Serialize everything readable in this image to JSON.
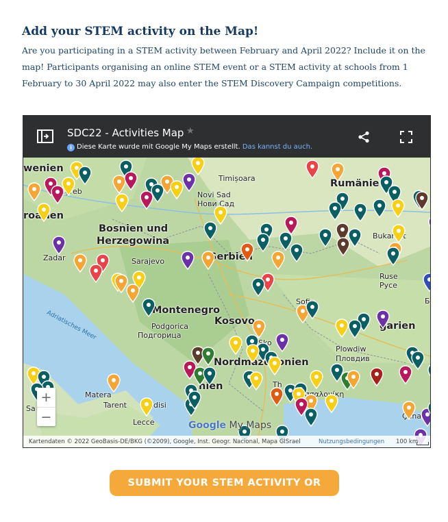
{
  "section": {
    "heading": "Add your STEM activity on the Map!",
    "intro": "Are you participating in a STEM activity between February and April 2022? Include it on the map! Participants organising an online STEM event or a STEM activity at schools from 1 February to 30 April 2022 may also enter the STEM Discovery Campaign competitions."
  },
  "map": {
    "title": "SDC22 - Activities Map",
    "star": "★",
    "info_text": "Diese Karte wurde mit Google My Maps erstellt.",
    "info_link": "Das kannst du auch.",
    "icons": {
      "sidebar": "sidebar-toggle-icon",
      "share": "share-icon",
      "fullscreen": "fullscreen-icon",
      "info": "info-icon"
    },
    "labels": {
      "slovenia": "wenien",
      "zagreb": "agreb",
      "croatia": "roatien",
      "timisoara": "Timișoara",
      "novisad": "Novi Sad",
      "novisad_cyr": "Нови Сад",
      "romania": "Rumänie",
      "bosnia1": "Bosnien und",
      "bosnia2": "Herzegowina",
      "zadar": "Zadar",
      "sarajevo": "Sarajevo",
      "serbia": "Serbien",
      "bucharest": "Bukarest",
      "ruse": "Ruse",
      "ruse_cyr": "Русе",
      "montenegro": "Montenegro",
      "adriatic": "Adriatisches Meer",
      "podgorica": "Podgorica",
      "podgorica_cyr": "Подгорица",
      "kosovo": "Kosovo",
      "sofia": "Sofia",
      "bulgaria": "garien",
      "skopje": "Sko",
      "plovdiv": "Plowdiw",
      "plovdiv_cyr": "Пловдив",
      "north_macedonia": "Nordmazedonien",
      "albania": "nien",
      "matera": "Matera",
      "taranto": "Tarent",
      "brindisi": "indisi",
      "thessaloniki": "Th",
      "thessaloniki2": "Θεσσαλονίκη",
      "lecce": "Lecce",
      "canakkale": "Çanal",
      "sa": "Sa",
      "bulg_abbr": "Б"
    },
    "zoom_in": "+",
    "zoom_out": "−",
    "google_g": "Google",
    "my_maps": "My Maps",
    "attribution": "Kartendaten © 2022 GeoBasis-DE/BKG (©2009), Google, Inst. Geogr. Nacional, Mapa GISrael",
    "terms": "Nutzungsbedingungen",
    "scale": "100 km",
    "pin_colors": {
      "teal": "#0b5f63",
      "yellow": "#f6cf16",
      "orange": "#f4a534",
      "magenta": "#b7195a",
      "purple": "#6a32a6",
      "red": "#e8454b",
      "brown": "#5c3a2e",
      "darkorange": "#df5a12",
      "green": "#2e7d32",
      "darkred": "#a3221c",
      "blue": "#2f4fb4"
    }
  },
  "cta": {
    "label": "SUBMIT YOUR STEM ACTIVITY OR EVENT"
  }
}
